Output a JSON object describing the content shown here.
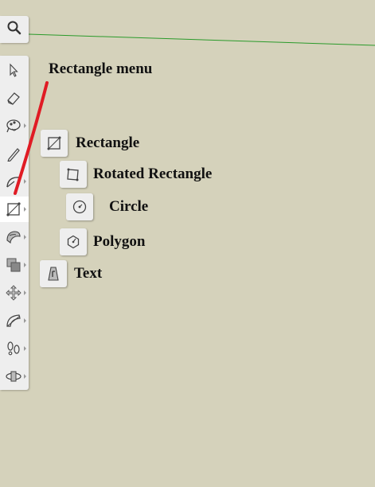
{
  "annotation": {
    "title": "Rectangle menu"
  },
  "menu": {
    "items": [
      {
        "label": "Rectangle",
        "icon": "rectangle-icon"
      },
      {
        "label": "Rotated Rectangle",
        "icon": "rotated-rectangle-icon"
      },
      {
        "label": "Circle",
        "icon": "circle-icon"
      },
      {
        "label": "Polygon",
        "icon": "polygon-icon"
      },
      {
        "label": "Text",
        "icon": "text-icon"
      }
    ]
  },
  "toolbar": {
    "tools": [
      {
        "icon": "select-arrow-icon"
      },
      {
        "icon": "eraser-icon"
      },
      {
        "icon": "paint-bucket-icon"
      },
      {
        "icon": "pencil-icon"
      },
      {
        "icon": "arc-icon"
      },
      {
        "icon": "rectangle-icon",
        "active": true
      },
      {
        "icon": "push-pull-icon"
      },
      {
        "icon": "offset-icon"
      },
      {
        "icon": "move-icon"
      },
      {
        "icon": "protractor-icon"
      },
      {
        "icon": "walk-icon"
      },
      {
        "icon": "orbit-icon"
      }
    ],
    "search_icon": "search-icon"
  },
  "colors": {
    "canvas_background": "#d5d2bb",
    "axis_line": "#2a9a2a",
    "annotation_line": "#e01b24"
  }
}
